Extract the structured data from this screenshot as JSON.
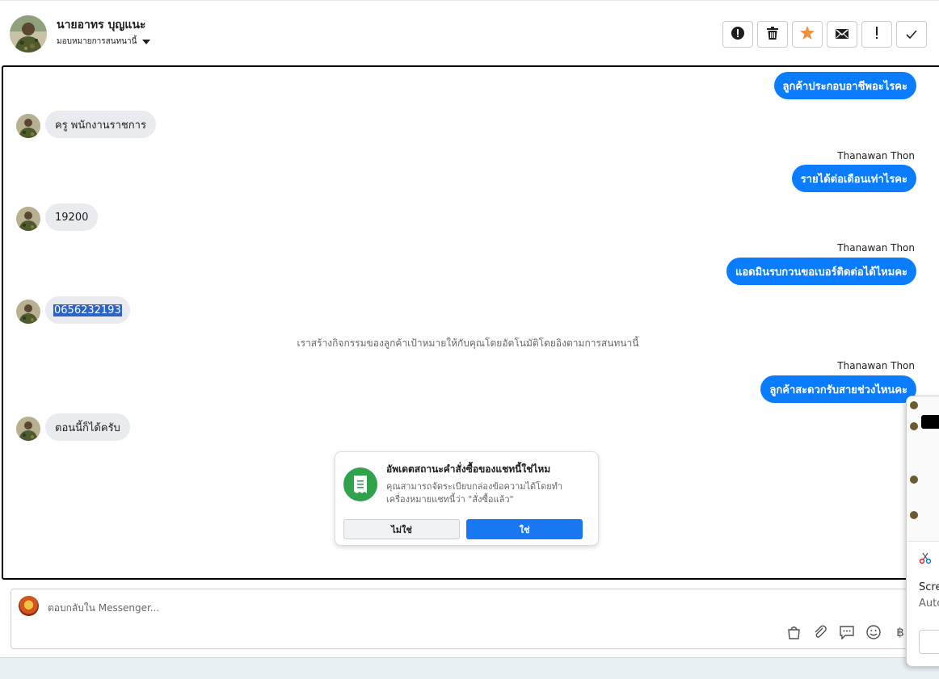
{
  "header": {
    "contact_name": "นายอาทร บุญแนะ",
    "assign_label": "มอบหมายการสนทนานี้",
    "actions": [
      {
        "name": "spam-button",
        "icon": "exclamation-circle-icon",
        "glyph": "!"
      },
      {
        "name": "delete-button",
        "icon": "trash-icon",
        "glyph": "🗑"
      },
      {
        "name": "star-button",
        "icon": "star-icon",
        "glyph": "★"
      },
      {
        "name": "mark-unread-button",
        "icon": "envelope-icon",
        "glyph": "✉"
      },
      {
        "name": "follow-up-button",
        "icon": "exclamation-icon",
        "glyph": "!"
      },
      {
        "name": "mark-done-button",
        "icon": "check-icon",
        "glyph": "✓"
      }
    ]
  },
  "messages": [
    {
      "dir": "out",
      "text": "ลูกค้าประกอบอาชีพอะไรคะ",
      "sender": ""
    },
    {
      "dir": "in",
      "text": "ครู พนักงานราชการ"
    },
    {
      "dir": "out",
      "text": "รายได้ต่อเดือนเท่าไรคะ",
      "sender": "Thanawan Thon"
    },
    {
      "dir": "in",
      "text": "19200"
    },
    {
      "dir": "out",
      "text": "แอดมินรบกวนขอเบอร์ติดต่อได้ไหมคะ",
      "sender": "Thanawan Thon"
    },
    {
      "dir": "in",
      "text": "0656232193",
      "selected": true
    },
    {
      "dir": "out",
      "text": "ลูกค้าสะดวกรับสายช่วงไหนคะ",
      "sender": "Thanawan Thon"
    },
    {
      "dir": "in",
      "text": "ตอนนี้ก็ได้ครับ"
    }
  ],
  "system_note": "เราสร้างกิจกรรมของลูกค้าเป้าหมายให้กับคุณโดยอัตโนมัติโดยอิงตามการสนทนานี้",
  "prompt": {
    "title": "อัพเดตสถานะคำสั่งซื้อของแชทนี้ใช่ไหม",
    "body": "คุณสามารถจัดระเบียบกล่องข้อความได้โดยทำเครื่องหมายแชทนี้ว่า \"สั่งซื้อแล้ว\"",
    "no_label": "ไม่ใช่",
    "yes_label": "ใช่",
    "icon": "receipt-icon",
    "accent": "#31a24c"
  },
  "composer": {
    "placeholder": "ตอบกลับใน Messenger...",
    "tools": [
      "shopping-bag-icon",
      "paperclip-icon",
      "saved-reply-icon",
      "emoji-icon",
      "baht-icon"
    ],
    "baht_glyph": "฿"
  },
  "overlay": {
    "line1": "Scre",
    "line2": "Auto"
  },
  "colors": {
    "outgoing": "#0a7cff",
    "incoming": "#e9ebee",
    "primary_button": "#1877f2"
  }
}
